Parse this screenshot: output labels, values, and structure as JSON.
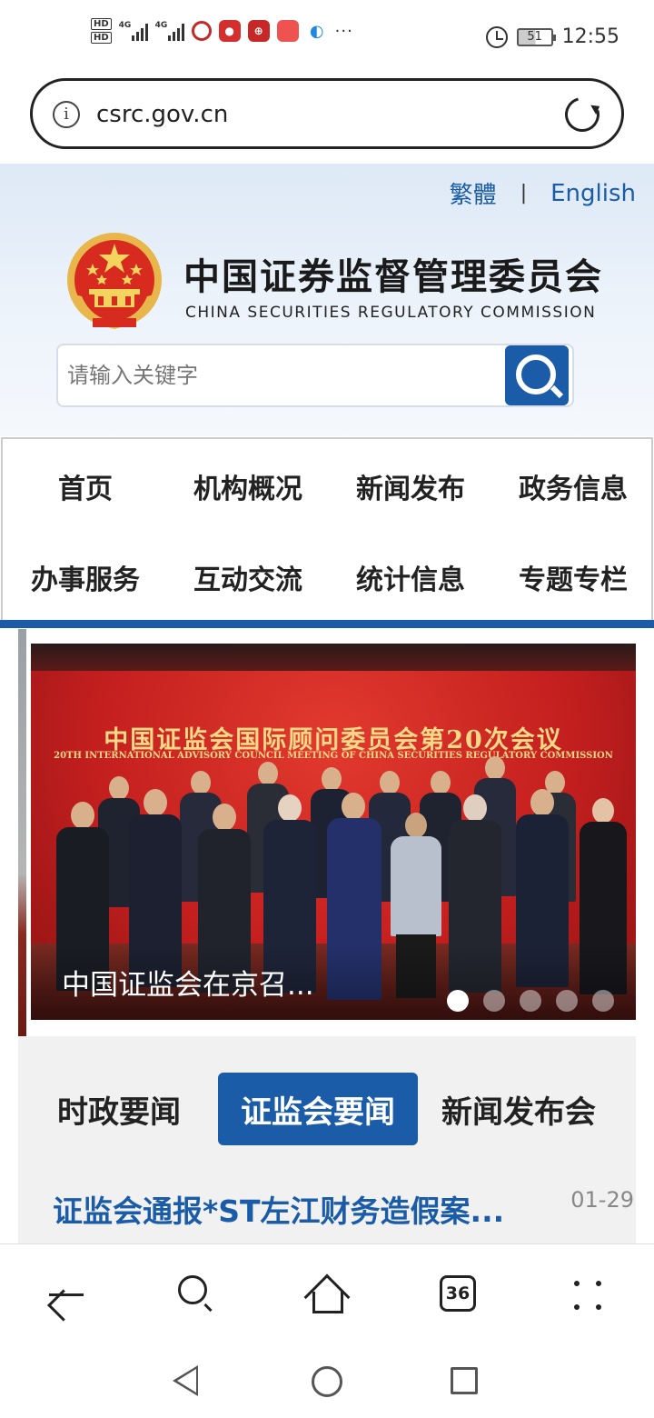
{
  "status_bar": {
    "hd1": "HD",
    "hd2": "HD",
    "signal1_label": "4G",
    "signal2_label": "4G",
    "more": "···",
    "battery": "51",
    "time": "12:55"
  },
  "browser": {
    "url": "csrc.gov.cn",
    "tabs_count": "36"
  },
  "header": {
    "lang_traditional": "繁體",
    "lang_separator": "|",
    "lang_english": "English",
    "title": "中国证券监督管理委员会",
    "subtitle": "CHINA SECURITIES REGULATORY COMMISSION",
    "search_placeholder": "请输入关键字"
  },
  "nav": {
    "items": [
      "首页",
      "机构概况",
      "新闻发布",
      "政务信息",
      "办事服务",
      "互动交流",
      "统计信息",
      "专题专栏"
    ]
  },
  "carousel": {
    "banner_title": "中国证监会国际顾问委员会第20次会议",
    "banner_subtitle": "20TH INTERNATIONAL ADVISORY COUNCIL MEETING OF CHINA SECURITIES REGULATORY COMMISSION",
    "caption": "中国证监会在京召...",
    "slide_count": 5,
    "active_slide": 1
  },
  "news": {
    "tabs": [
      "时政要闻",
      "证监会要闻",
      "新闻发布会"
    ],
    "active_tab": "证监会要闻",
    "items": [
      {
        "title": "证监会通报*ST左江财务造假案...",
        "date": "01-29"
      }
    ]
  },
  "colors": {
    "brand_blue": "#1a5ca8",
    "banner_red": "#c41f1f",
    "banner_gold": "#f6d887"
  }
}
